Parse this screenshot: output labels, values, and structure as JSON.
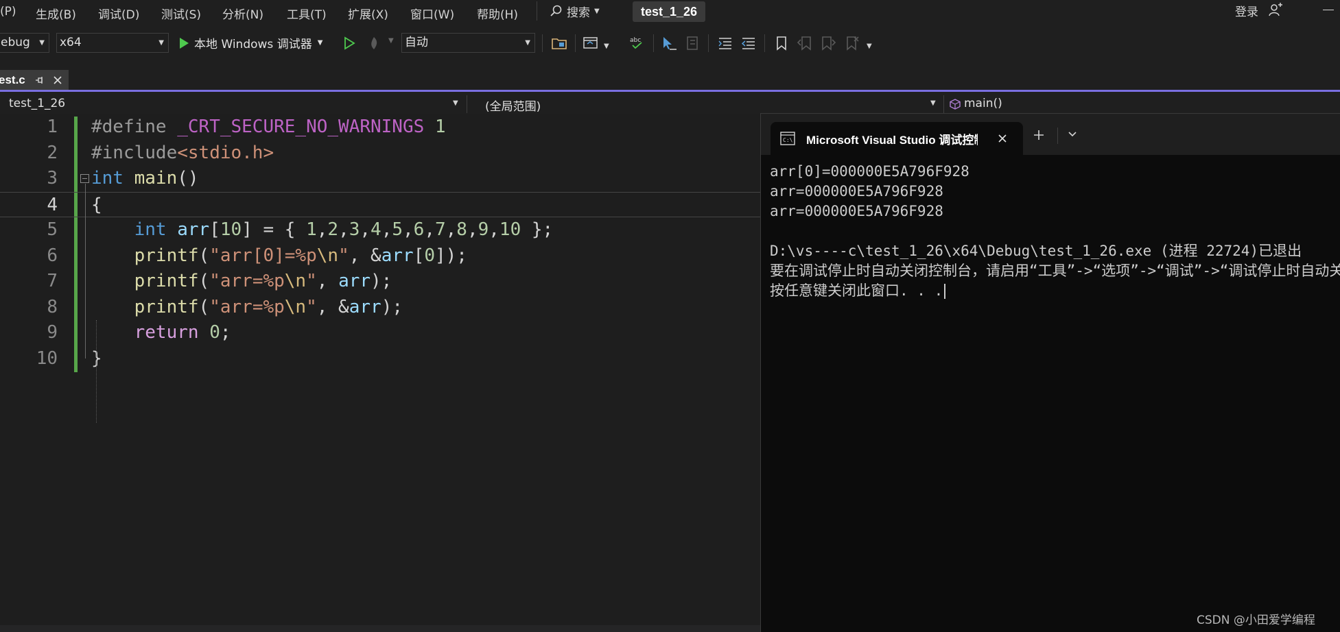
{
  "menu": {
    "items": [
      "(P)",
      "生成(B)",
      "调试(D)",
      "测试(S)",
      "分析(N)",
      "工具(T)",
      "扩展(X)",
      "窗口(W)",
      "帮助(H)"
    ],
    "search_label": "搜索",
    "solution_title": "test_1_26",
    "login_label": "登录"
  },
  "toolbar": {
    "config": "ebug",
    "platform": "x64",
    "run_label": "本地 Windows 调试器",
    "startup_mode": "自动"
  },
  "tabs": {
    "active_file": "est.c"
  },
  "navbar": {
    "project": "test_1_26",
    "scope": "(全局范围)",
    "member": "main()"
  },
  "editor": {
    "current_line": 4,
    "lines": [
      {
        "no": "1",
        "tokens": [
          [
            "k-pre",
            "#define"
          ],
          [
            "",
            " "
          ],
          [
            "k-macro",
            "_CRT_SECURE_NO_WARNINGS"
          ],
          [
            "",
            " "
          ],
          [
            "k-num",
            "1"
          ]
        ]
      },
      {
        "no": "2",
        "tokens": [
          [
            "k-pre",
            "#include"
          ],
          [
            "k-inc",
            "<stdio.h>"
          ]
        ]
      },
      {
        "no": "3",
        "tokens": [
          [
            "k-kw",
            "int"
          ],
          [
            "",
            " "
          ],
          [
            "k-fn",
            "main"
          ],
          [
            "",
            "()"
          ]
        ]
      },
      {
        "no": "4",
        "tokens": [
          [
            "",
            "{"
          ]
        ]
      },
      {
        "no": "5",
        "tokens": [
          [
            "",
            "    "
          ],
          [
            "k-kw",
            "int"
          ],
          [
            "",
            " "
          ],
          [
            "k-var",
            "arr"
          ],
          [
            "",
            "["
          ],
          [
            "k-num",
            "10"
          ],
          [
            "",
            "] = { "
          ],
          [
            "k-num",
            "1"
          ],
          [
            "",
            ","
          ],
          [
            "k-num",
            "2"
          ],
          [
            "",
            ","
          ],
          [
            "k-num",
            "3"
          ],
          [
            "",
            ","
          ],
          [
            "k-num",
            "4"
          ],
          [
            "",
            ","
          ],
          [
            "k-num",
            "5"
          ],
          [
            "",
            ","
          ],
          [
            "k-num",
            "6"
          ],
          [
            "",
            ","
          ],
          [
            "k-num",
            "7"
          ],
          [
            "",
            ","
          ],
          [
            "k-num",
            "8"
          ],
          [
            "",
            ","
          ],
          [
            "k-num",
            "9"
          ],
          [
            "",
            ","
          ],
          [
            "k-num",
            "10"
          ],
          [
            "",
            " };"
          ]
        ]
      },
      {
        "no": "6",
        "tokens": [
          [
            "",
            "    "
          ],
          [
            "k-fn",
            "printf"
          ],
          [
            "",
            "("
          ],
          [
            "k-str",
            "\"arr[0]=%p"
          ],
          [
            "k-esc",
            "\\n"
          ],
          [
            "k-str",
            "\""
          ],
          [
            "",
            ", &"
          ],
          [
            "k-var",
            "arr"
          ],
          [
            "",
            "["
          ],
          [
            "k-num",
            "0"
          ],
          [
            "",
            "]);"
          ]
        ]
      },
      {
        "no": "7",
        "tokens": [
          [
            "",
            "    "
          ],
          [
            "k-fn",
            "printf"
          ],
          [
            "",
            "("
          ],
          [
            "k-str",
            "\"arr=%p"
          ],
          [
            "k-esc",
            "\\n"
          ],
          [
            "k-str",
            "\""
          ],
          [
            "",
            ", "
          ],
          [
            "k-var",
            "arr"
          ],
          [
            "",
            ");"
          ]
        ]
      },
      {
        "no": "8",
        "tokens": [
          [
            "",
            "    "
          ],
          [
            "k-fn",
            "printf"
          ],
          [
            "",
            "("
          ],
          [
            "k-str",
            "\"arr=%p"
          ],
          [
            "k-esc",
            "\\n"
          ],
          [
            "k-str",
            "\""
          ],
          [
            "",
            ", &"
          ],
          [
            "k-var",
            "arr"
          ],
          [
            "",
            ");"
          ]
        ]
      },
      {
        "no": "9",
        "tokens": [
          [
            "",
            "    "
          ],
          [
            "k-ctl",
            "return"
          ],
          [
            "",
            " "
          ],
          [
            "k-num",
            "0"
          ],
          [
            "",
            ";"
          ]
        ]
      },
      {
        "no": "10",
        "tokens": [
          [
            "",
            "}"
          ]
        ]
      }
    ]
  },
  "console": {
    "tab_title": "Microsoft Visual Studio 调试控制台",
    "lines": [
      "arr[0]=000000E5A796F928",
      "arr=000000E5A796F928",
      "arr=000000E5A796F928",
      "",
      "D:\\vs----c\\test_1_26\\x64\\Debug\\test_1_26.exe (进程 22724)已退出",
      "要在调试停止时自动关闭控制台，请启用“工具”->“选项”->“调试”->“调试停止时自动关闭控制台”。",
      "按任意键关闭此窗口. . ."
    ]
  },
  "watermark": "CSDN @小田爱学编程",
  "colors": {
    "accent": "#7a6fe0",
    "change_bar": "#57a64a",
    "run_green": "#4ec94e"
  }
}
